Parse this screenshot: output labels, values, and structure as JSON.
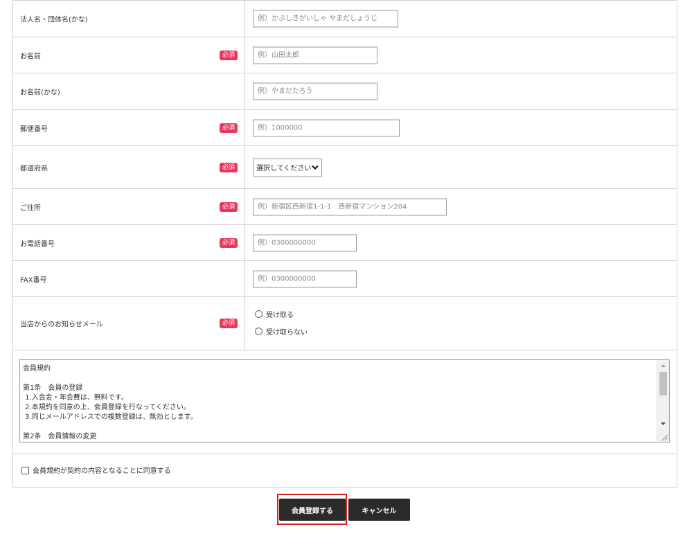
{
  "form": {
    "fields": [
      {
        "label": "法人名・団体名(かな)",
        "required": false,
        "placeholder": "例）かぶしきがいしゃ やまだしょうじ"
      },
      {
        "label": "お名前",
        "required": true,
        "placeholder": "例）山田太郎"
      },
      {
        "label": "お名前(かな)",
        "required": false,
        "placeholder": "例）やまだたろう"
      },
      {
        "label": "郵便番号",
        "required": true,
        "placeholder": "例）1000000"
      },
      {
        "label": "都道府県",
        "required": true,
        "select_value": "選択してください"
      },
      {
        "label": "ご住所",
        "required": true,
        "placeholder": "例）新宿区西新宿1-1-1　西新宿マンション204"
      },
      {
        "label": "お電話番号",
        "required": true,
        "placeholder": "例）0300000000"
      },
      {
        "label": "FAX番号",
        "required": false,
        "placeholder": "例）0300000000"
      },
      {
        "label": "当店からのお知らせメール",
        "required": true,
        "options": [
          "受け取る",
          "受け取らない"
        ]
      }
    ],
    "required_badge": "必須"
  },
  "terms": {
    "text": "会員規約\n\n第1条　会員の登録\n 1.入会金・年会費は、無料です。\n 2.本規約を同意の上、会員登録を行なってください。\n 3.同じメールアドレスでの複数登録は、無効とします。\n\n第2条　会員情報の変更"
  },
  "agree": {
    "label": "会員規約が契約の内容となることに同意する",
    "checked": false
  },
  "buttons": {
    "register": "会員登録する",
    "cancel": "キャンセル"
  },
  "colors": {
    "required_badge": "#e8375a",
    "button_bg": "#2b2b2b",
    "highlight": "#d81e1e",
    "border": "#cfcfcf"
  }
}
